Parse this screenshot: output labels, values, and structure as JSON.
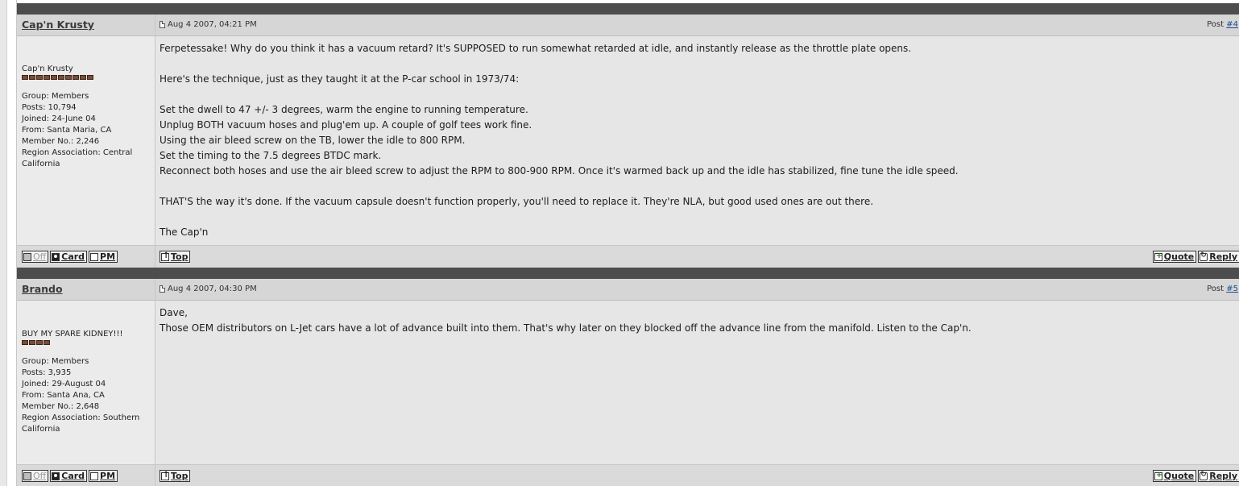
{
  "posts": [
    {
      "author": "Cap'n Krusty",
      "date": "Aug 4 2007, 04:21 PM",
      "post_label": "Post",
      "post_num": "#4",
      "title": "Cap'n Krusty",
      "pip_count": 10,
      "info": [
        "Group: Members",
        "Posts: 10,794",
        "Joined: 24-June 04",
        "From: Santa Maria, CA",
        "Member No.: 2,246",
        "Region Association: Central",
        "California"
      ],
      "message": [
        "Ferpetessake! Why do you think it has a vacuum retard? It's SUPPOSED to run somewhat retarded at idle, and instantly release as the throttle plate opens.",
        "",
        "Here's the technique, just as they taught it at the P-car school in 1973/74:",
        "",
        "Set the dwell to 47 +/- 3 degrees, warm the engine to running temperature.",
        "Unplug BOTH vacuum hoses and plug'em up. A couple of golf tees work fine.",
        "Using the air bleed screw on the TB, lower the idle to 800 RPM.",
        "Set the timing to the 7.5 degrees BTDC mark.",
        "Reconnect both hoses and use the air bleed screw to adjust the RPM to 800-900 RPM. Once it's warmed back up and the idle has stabilized, fine tune the idle speed.",
        "",
        "THAT'S the way it's done. If the vacuum capsule doesn't function properly, you'll need to replace it. They're NLA, but good used ones are out there.",
        "",
        "The Cap'n"
      ]
    },
    {
      "author": "Brando",
      "date": "Aug 4 2007, 04:30 PM",
      "post_label": "Post",
      "post_num": "#5",
      "title": "BUY MY SPARE KIDNEY!!!",
      "pip_count": 4,
      "info": [
        "Group: Members",
        "Posts: 3,935",
        "Joined: 29-August 04",
        "From: Santa Ana, CA",
        "Member No.: 2,648",
        "Region Association: Southern",
        "California"
      ],
      "message": [
        "Dave,",
        "Those OEM distributors on L-Jet cars have a lot of advance built into them. That's why later on they blocked off the advance line from the manifold. Listen to the Cap'n."
      ]
    }
  ],
  "buttons": {
    "off": "Off",
    "card": "Card",
    "pm": "PM",
    "top": "Top",
    "quote": "Quote",
    "reply": "Reply"
  }
}
